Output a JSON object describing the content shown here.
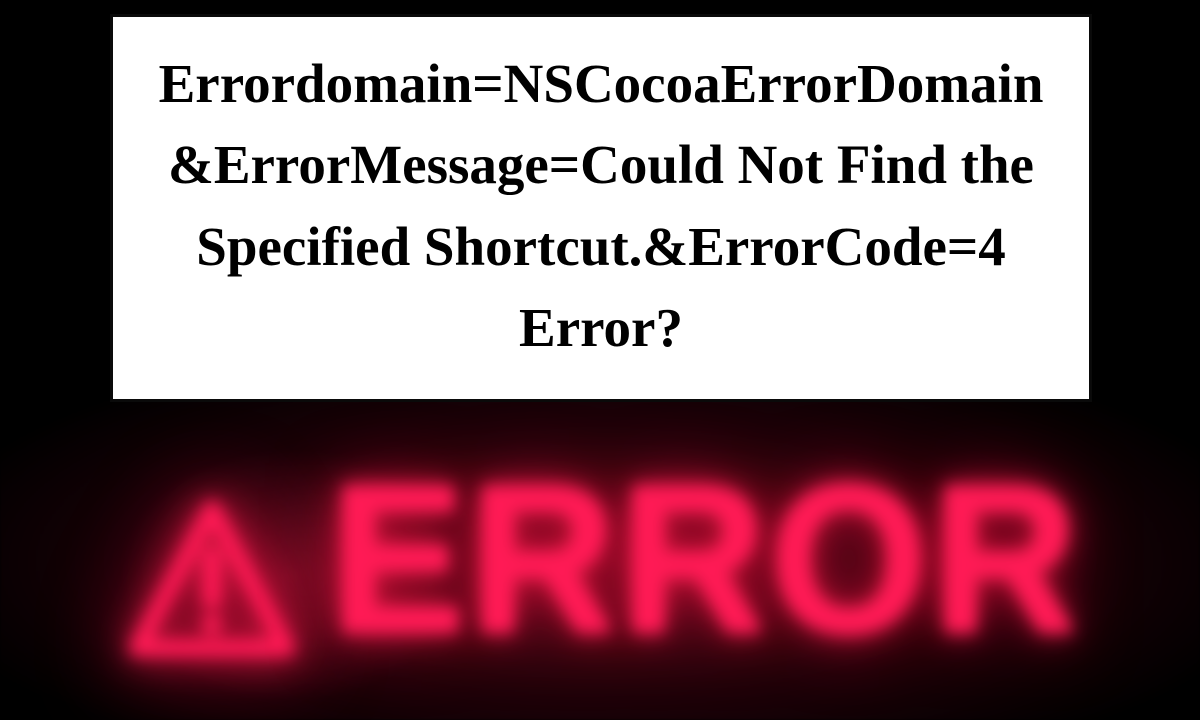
{
  "headline": "Errordomain=NSCocoaErrorDomain&ErrorMessage=Could Not Find the Specified Shortcut.&ErrorCode=4 Error?",
  "neon": {
    "word": "ERROR",
    "color": "#ff1a55"
  }
}
